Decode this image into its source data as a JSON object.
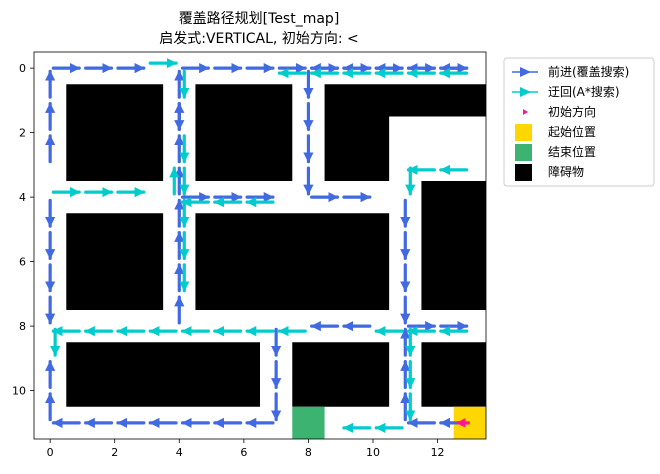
{
  "chart_data": {
    "type": "grid-path",
    "title_line1": "覆盖路径规划[Test_map]",
    "title_line2": "启发式:VERTICAL, 初始方向: <",
    "xlabel": "",
    "ylabel": "",
    "xlim": [
      -0.5,
      13.5
    ],
    "ylim": [
      11.5,
      -0.5
    ],
    "y_inverted": true,
    "xticks": [
      0,
      2,
      4,
      6,
      8,
      10,
      12
    ],
    "yticks": [
      0,
      2,
      4,
      6,
      8,
      10
    ],
    "grid": false,
    "legend_position": "outside-upper-right",
    "colors": {
      "forward": "#4169e1",
      "astar": "#00cccc",
      "init_dir": "#ff1493",
      "start": "#ffd700",
      "end": "#3cb371",
      "obstacle": "#000000",
      "free": "#ffffff"
    },
    "legend": [
      {
        "key": "forward",
        "label": "前进(覆盖搜索)",
        "style": "line-arrow"
      },
      {
        "key": "astar",
        "label": "迂回(A*搜索)",
        "style": "line-arrow"
      },
      {
        "key": "init_dir",
        "label": "初始方向",
        "style": "small-arrow"
      },
      {
        "key": "start",
        "label": "起始位置",
        "style": "square"
      },
      {
        "key": "end",
        "label": "结束位置",
        "style": "square"
      },
      {
        "key": "obstacle",
        "label": "障碍物",
        "style": "square"
      }
    ],
    "obstacles": [
      [
        1,
        3,
        1,
        3
      ],
      [
        5,
        7,
        1,
        3
      ],
      [
        9,
        13,
        1,
        1
      ],
      [
        9,
        10,
        2,
        3
      ],
      [
        1,
        3,
        5,
        7
      ],
      [
        5,
        10,
        5,
        7
      ],
      [
        12,
        13,
        4,
        7
      ],
      [
        1,
        6,
        9,
        10
      ],
      [
        8,
        10,
        9,
        10
      ],
      [
        12,
        13,
        9,
        10
      ]
    ],
    "start": [
      13,
      11
    ],
    "end": [
      8,
      11
    ],
    "init_direction": {
      "at": [
        13,
        11
      ],
      "to": [
        12.6,
        11
      ]
    },
    "forward_paths": [
      [
        [
          13,
          11
        ],
        [
          12,
          11
        ],
        [
          11,
          11
        ],
        [
          11,
          10
        ],
        [
          11,
          9
        ],
        [
          11,
          8
        ],
        [
          12,
          8
        ],
        [
          13,
          8
        ]
      ],
      [
        [
          10,
          8
        ],
        [
          9,
          8
        ],
        [
          8,
          8
        ]
      ],
      [
        [
          7,
          11
        ],
        [
          6,
          11
        ],
        [
          5,
          11
        ],
        [
          4,
          11
        ],
        [
          3,
          11
        ],
        [
          2,
          11
        ],
        [
          1,
          11
        ],
        [
          0,
          11
        ],
        [
          0,
          10
        ],
        [
          0,
          9
        ]
      ],
      [
        [
          0,
          4
        ],
        [
          0,
          5
        ],
        [
          0,
          6
        ],
        [
          0,
          7
        ],
        [
          0,
          8
        ]
      ],
      [
        [
          7,
          8
        ],
        [
          7,
          9
        ],
        [
          7,
          10
        ],
        [
          7,
          11
        ]
      ],
      [
        [
          4,
          8
        ],
        [
          4,
          7
        ],
        [
          4,
          6
        ],
        [
          4,
          5
        ],
        [
          4,
          4
        ],
        [
          4,
          3
        ],
        [
          4,
          2
        ],
        [
          4,
          1
        ],
        [
          4,
          0
        ],
        [
          5,
          0
        ],
        [
          6,
          0
        ],
        [
          7,
          0
        ],
        [
          8,
          0
        ],
        [
          9,
          0
        ],
        [
          10,
          0
        ],
        [
          11,
          0
        ],
        [
          12,
          0
        ],
        [
          13,
          0
        ]
      ],
      [
        [
          13,
          0
        ],
        [
          12,
          0
        ],
        [
          11,
          0
        ],
        [
          10,
          0
        ],
        [
          9,
          0
        ],
        [
          8,
          0
        ],
        [
          8,
          1
        ],
        [
          8,
          2
        ],
        [
          8,
          3
        ],
        [
          8,
          4
        ],
        [
          9,
          4
        ],
        [
          10,
          4
        ]
      ],
      [
        [
          11,
          4
        ],
        [
          11,
          5
        ],
        [
          11,
          6
        ],
        [
          11,
          7
        ],
        [
          11,
          8
        ]
      ],
      [
        [
          4,
          4
        ],
        [
          5,
          4
        ],
        [
          6,
          4
        ],
        [
          7,
          4
        ]
      ],
      [
        [
          0,
          3
        ],
        [
          0,
          2
        ],
        [
          0,
          1
        ],
        [
          0,
          0
        ],
        [
          1,
          0
        ],
        [
          2,
          0
        ],
        [
          3,
          0
        ]
      ],
      [
        [
          4,
          1
        ],
        [
          4,
          2
        ]
      ]
    ],
    "astar_paths": [
      [
        [
          13,
          8
        ],
        [
          12,
          8
        ],
        [
          11,
          8
        ],
        [
          10,
          8
        ]
      ],
      [
        [
          8,
          8
        ],
        [
          7,
          8
        ],
        [
          6,
          8
        ],
        [
          5,
          8
        ],
        [
          4,
          8
        ],
        [
          3,
          8
        ],
        [
          2,
          8
        ],
        [
          1,
          8
        ],
        [
          0,
          8
        ],
        [
          0,
          9
        ]
      ],
      [
        [
          0,
          4
        ],
        [
          1,
          4
        ],
        [
          2,
          4
        ],
        [
          3,
          4
        ]
      ],
      [
        [
          13,
          0
        ],
        [
          12,
          0
        ],
        [
          11,
          0
        ],
        [
          10,
          0
        ],
        [
          9,
          0
        ],
        [
          8,
          0
        ],
        [
          7,
          0
        ]
      ],
      [
        [
          3,
          0
        ],
        [
          4,
          0
        ],
        [
          4,
          1
        ]
      ],
      [
        [
          4,
          2
        ],
        [
          4,
          3
        ],
        [
          4,
          4
        ],
        [
          4,
          5
        ],
        [
          4,
          6
        ],
        [
          4,
          7
        ]
      ],
      [
        [
          7,
          4
        ],
        [
          6,
          4
        ],
        [
          5,
          4
        ],
        [
          4,
          4
        ],
        [
          4,
          3
        ]
      ],
      [
        [
          13,
          3
        ],
        [
          12,
          3
        ],
        [
          11,
          3
        ],
        [
          11,
          4
        ]
      ],
      [
        [
          11,
          8
        ],
        [
          11,
          9
        ],
        [
          11,
          10
        ],
        [
          11,
          11
        ],
        [
          10,
          11
        ],
        [
          9,
          11
        ]
      ]
    ]
  }
}
